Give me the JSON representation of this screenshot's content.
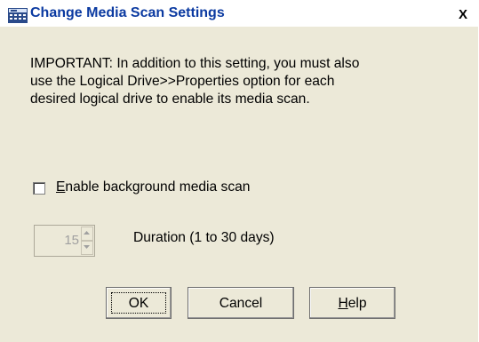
{
  "window": {
    "title": "Change Media Scan Settings",
    "close_label": "X",
    "icon": "grid-app-icon"
  },
  "notice": {
    "text": "IMPORTANT: In addition to this setting, you must also\nuse the Logical Drive>>Properties option for each\ndesired logical drive to enable its media scan."
  },
  "media_scan": {
    "checkbox_checked": false,
    "label_mnemonic": "E",
    "label_rest": "nable background media scan"
  },
  "duration": {
    "value": "15",
    "label": "Duration (1 to 30 days)"
  },
  "buttons": {
    "ok": "OK",
    "cancel": "Cancel",
    "help_mnemonic": "H",
    "help_rest": "elp"
  },
  "colors": {
    "title_text": "#0b3aa1",
    "dialog_bg": "#ece9d8",
    "disabled_text": "#a0a0a0"
  }
}
